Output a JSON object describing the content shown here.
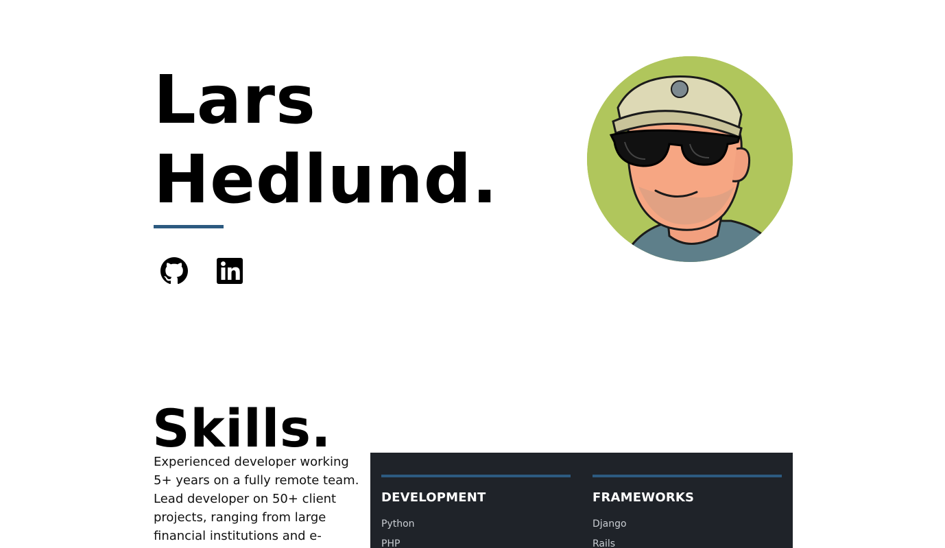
{
  "hero": {
    "name_line1": "Lars",
    "name_line2": "Hedlund.",
    "accent_color": "#2c5a80"
  },
  "social": [
    {
      "icon": "github-icon"
    },
    {
      "icon": "linkedin-icon"
    }
  ],
  "avatar": {
    "icon": "avatar-illustration",
    "background_color": "#b0c65c"
  },
  "skills": {
    "title": "Skills.",
    "description": "Experienced developer working 5+ years on a fully remote team. Lead developer on 50+ client projects, ranging from large financial institutions and e-",
    "panel_color": "#1f2329",
    "categories": [
      {
        "heading": "DEVELOPMENT",
        "items": [
          "Python",
          "PHP"
        ]
      },
      {
        "heading": "FRAMEWORKS",
        "items": [
          "Django",
          "Rails"
        ]
      }
    ]
  }
}
